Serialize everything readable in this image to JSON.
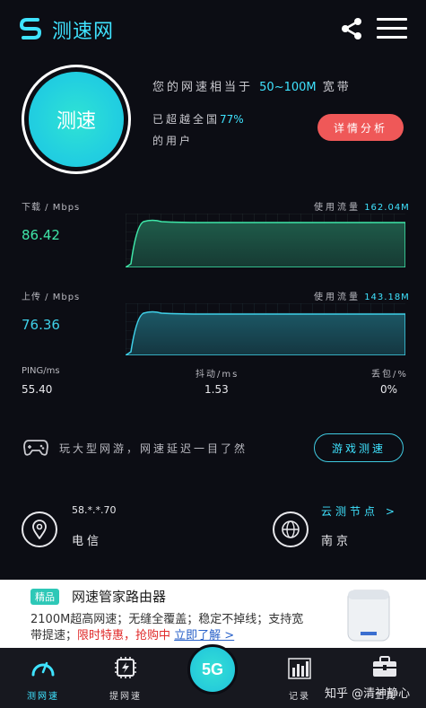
{
  "header": {
    "app_title": "测速网"
  },
  "speed_button_label": "测速",
  "compare": {
    "prefix": "您的网速相当于",
    "range": "50~100M",
    "suffix": "宽带",
    "beat_prefix": "已超越全国",
    "beat_percent": "77%",
    "beat_suffix": "的用户",
    "detail_button": "详情分析"
  },
  "download": {
    "label": "下载 / Mbps",
    "value": "86.42",
    "usage_label": "使用流量",
    "usage_value": "162.04M",
    "color": "#3fe6a8"
  },
  "upload": {
    "label": "上传 / Mbps",
    "value": "76.36",
    "usage_label": "使用流量",
    "usage_value": "143.18M",
    "color": "#3fd0e8"
  },
  "stats": {
    "ping_label": "PING/ms",
    "ping_value": "55.40",
    "jitter_label": "抖动/ms",
    "jitter_value": "1.53",
    "loss_label": "丢包/%",
    "loss_value": "0%"
  },
  "game": {
    "text": "玩大型网游，网速延迟一目了然",
    "button": "游戏测速"
  },
  "location": {
    "ip": "58.*.*.70",
    "isp": "电信",
    "node_label": "云测节点 >",
    "node_city": "南京"
  },
  "ad": {
    "tag": "精品",
    "title": "网速管家路由器",
    "line1": "2100M超高网速；无缝全覆盖；稳定不掉线；支持宽",
    "line2_prefix": "带提速；",
    "line2_red": "限时特惠，抢购中",
    "line2_link": "立即了解 >"
  },
  "nav": {
    "items": [
      {
        "label": "测网速",
        "icon": "speedometer-icon"
      },
      {
        "label": "提网速",
        "icon": "chip-lightning-icon"
      },
      {
        "label": "5G",
        "icon": "5g-icon"
      },
      {
        "label": "记录",
        "icon": "bar-chart-icon"
      },
      {
        "label": "工具",
        "icon": "toolbox-icon"
      }
    ]
  },
  "watermark": "知乎 @清神静心"
}
